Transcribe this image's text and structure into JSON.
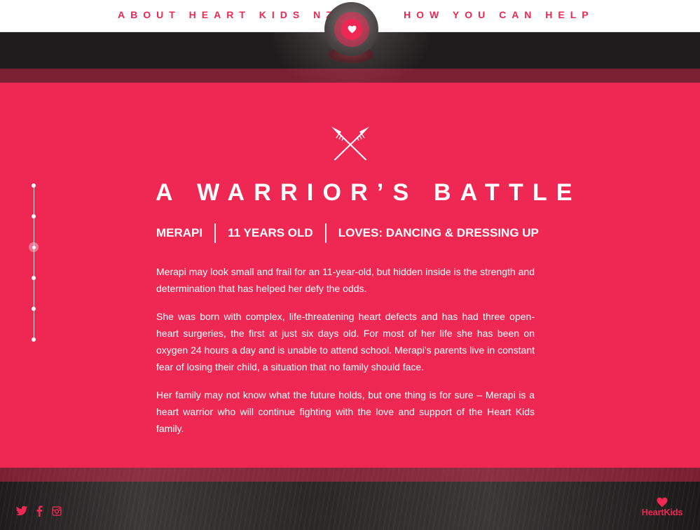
{
  "nav": {
    "left_label": "ABOUT HEART KIDS NZ",
    "right_label": "HOW YOU CAN HELP",
    "logo_icon": "heart-icon"
  },
  "colors": {
    "accent": "#ee2852",
    "text_on_accent": "#ffffff",
    "nav_background": "#ffffff"
  },
  "timeline": {
    "dot_count": 6,
    "active_index": 2
  },
  "story": {
    "icon": "crossed-spears-icon",
    "title": "A WARRIOR’S BATTLE",
    "facts": [
      "MERAPI",
      "11 YEARS OLD",
      "LOVES: DANCING & DRESSING UP"
    ],
    "paragraphs": [
      "Merapi may look small and frail for an 11-year-old, but hidden inside is the strength and determination that has helped her defy the odds.",
      "She was born with complex, life-threatening heart defects and has had three open-heart surgeries, the first at just six days old. For most of her life she has been on oxygen 24 hours a day and is unable to attend school. Merapi’s parents live in constant fear of losing their child, a situation that no family should face.",
      "Her family may not know what the future holds, but one thing is for sure – Merapi is a heart warrior who will continue fighting with the love and support of the Heart Kids family."
    ]
  },
  "footer": {
    "social": [
      "twitter-icon",
      "facebook-icon",
      "instagram-icon"
    ],
    "brand_label": "HeartKids"
  }
}
